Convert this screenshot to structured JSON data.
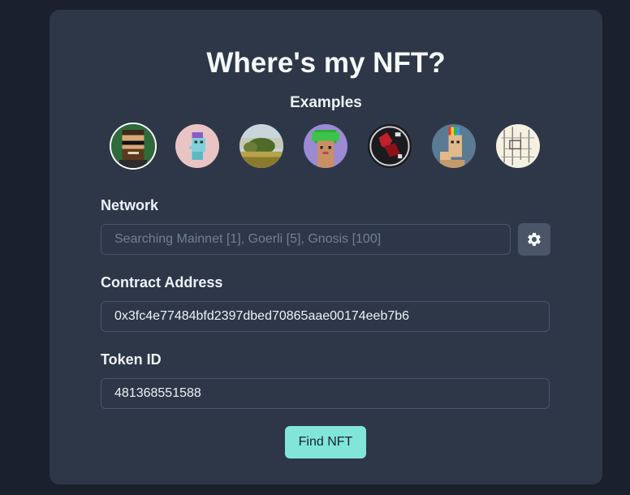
{
  "page": {
    "title": "Where's my NFT?",
    "examples_label": "Examples"
  },
  "examples": [
    {
      "icon": "bearded-man-pixel-avatar-icon",
      "selected": true
    },
    {
      "icon": "pixel-punk-blue-avatar-icon",
      "selected": false
    },
    {
      "icon": "landscape-painting-avatar-icon",
      "selected": false
    },
    {
      "icon": "green-hair-pixel-avatar-icon",
      "selected": false
    },
    {
      "icon": "red-figure-avatar-icon",
      "selected": false
    },
    {
      "icon": "rainbow-hat-ape-avatar-icon",
      "selected": false
    },
    {
      "icon": "sketch-artwork-avatar-icon",
      "selected": false
    }
  ],
  "form": {
    "network_label": "Network",
    "network_placeholder": "Searching Mainnet [1], Goerli [5], Gnosis [100]",
    "contract_label": "Contract Address",
    "contract_value": "0x3fc4e77484bfd2397dbed70865aae00174eeb7b6",
    "token_label": "Token ID",
    "token_value": "481368551588",
    "submit_label": "Find NFT",
    "settings_icon": "gear-icon"
  },
  "colors": {
    "background": "#1a202c",
    "card": "#2d3748",
    "accent": "#81e6d9"
  }
}
